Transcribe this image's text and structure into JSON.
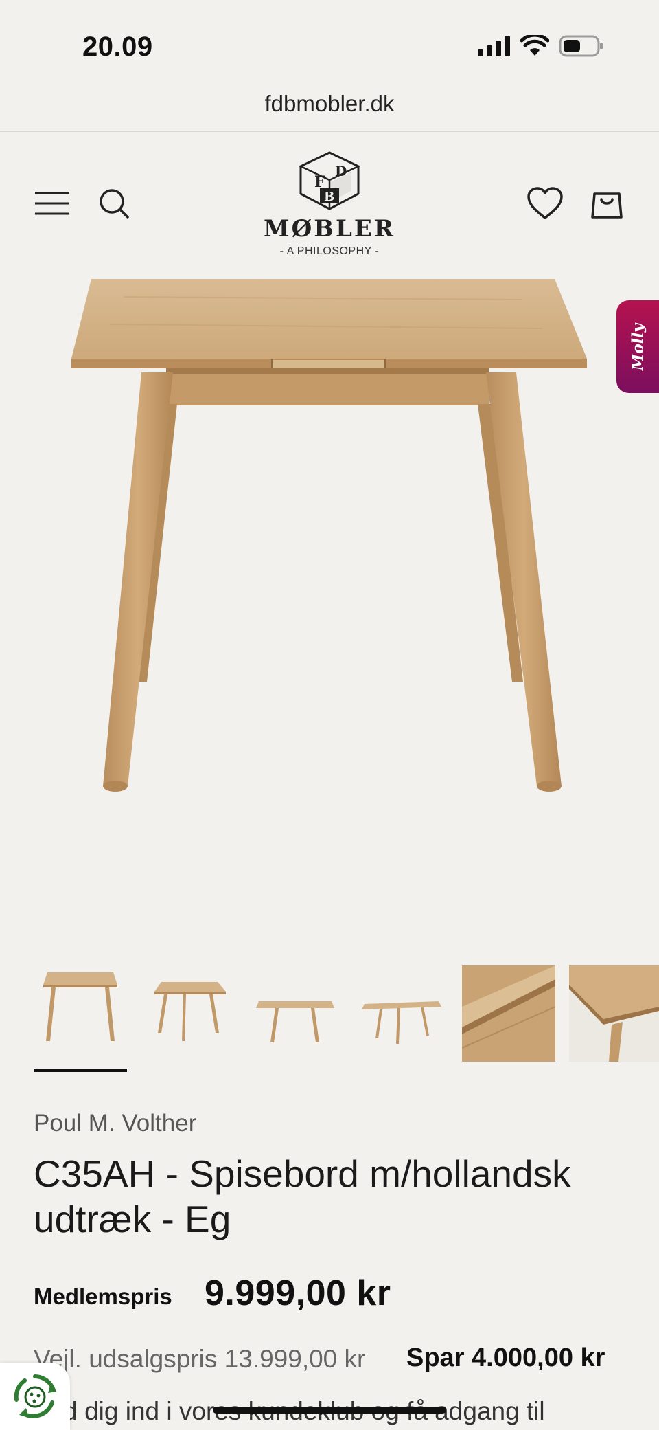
{
  "status_bar": {
    "time": "20.09"
  },
  "browser": {
    "url": "fdbmobler.dk"
  },
  "header": {
    "logo": {
      "letters": [
        "F",
        "D",
        "B"
      ],
      "wordmark": "MØBLER",
      "tagline": "- A PHILOSOPHY -"
    },
    "icons": [
      "menu-icon",
      "search-icon",
      "heart-icon",
      "bag-icon"
    ]
  },
  "chat_widget": {
    "label": "Molly",
    "color_start": "#b5124f",
    "color_end": "#7b0f5e"
  },
  "gallery": {
    "thumbnail_count": 6,
    "active_index": 0
  },
  "product": {
    "designer": "Poul M. Volther",
    "title": "C35AH - Spisebord m/hollandsk udtræk - Eg",
    "member_price_label": "Medlemspris",
    "member_price": "9.999,00 kr",
    "rrp": "Vejl. udsalgspris 13.999,00 kr",
    "savings": "Spar 4.000,00 kr",
    "club_text": "ld dig ind i vores kundeklub og få adgang til"
  },
  "colors": {
    "background": "#f2f1ed",
    "text": "#1c1c1c",
    "wood": "#d4b287"
  }
}
